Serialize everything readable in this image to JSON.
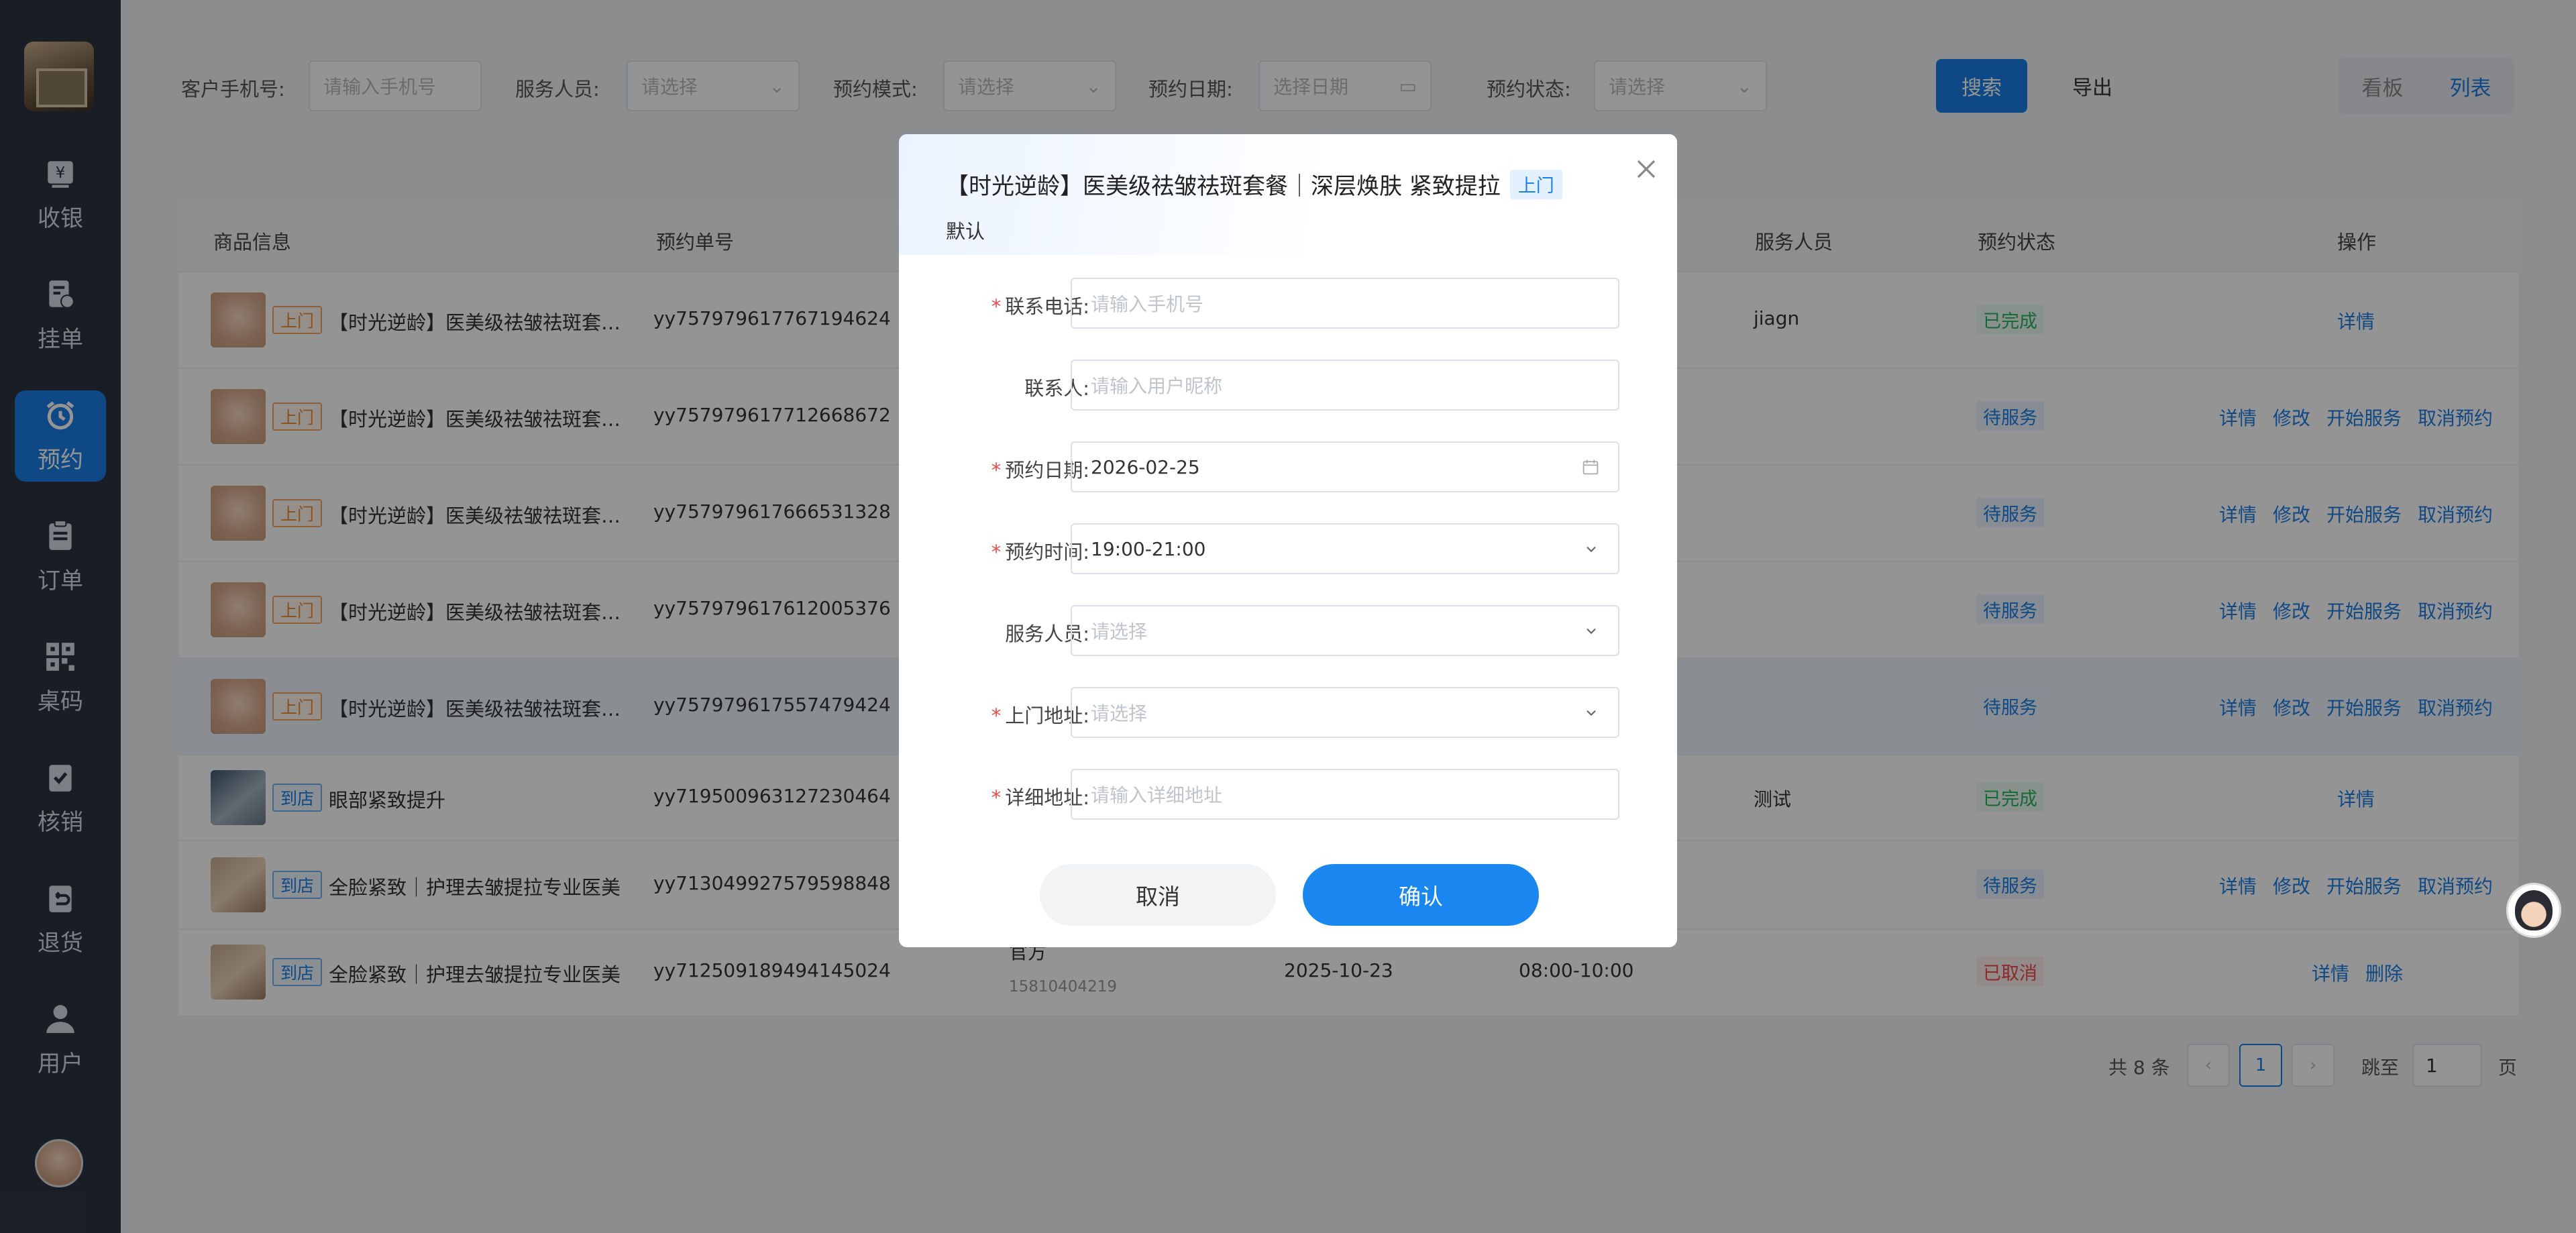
{
  "sidebar": {
    "items": [
      {
        "label": "收银",
        "icon": "cashier-icon"
      },
      {
        "label": "挂单",
        "icon": "hold-order-icon"
      },
      {
        "label": "预约",
        "icon": "alarm-clock-icon"
      },
      {
        "label": "订单",
        "icon": "clipboard-icon"
      },
      {
        "label": "桌码",
        "icon": "qr-code-icon"
      },
      {
        "label": "核销",
        "icon": "check-clipboard-icon"
      },
      {
        "label": "退货",
        "icon": "return-icon"
      },
      {
        "label": "用户",
        "icon": "user-icon"
      }
    ]
  },
  "filters": {
    "phone_label": "客户手机号:",
    "phone_placeholder": "请输入手机号",
    "staff_label": "服务人员:",
    "staff_placeholder": "请选择",
    "mode_label": "预约模式:",
    "mode_placeholder": "请选择",
    "date_label": "预约日期:",
    "date_placeholder": "选择日期",
    "status_label": "预约状态:",
    "status_placeholder": "请选择",
    "search": "搜索",
    "export": "导出",
    "view_board": "看板",
    "view_list": "列表"
  },
  "table": {
    "headers": {
      "product": "商品信息",
      "order_no": "预约单号",
      "staff": "服务人员",
      "status": "预约状态",
      "ops": "操作"
    },
    "rows": [
      {
        "tag": "上门",
        "name": "【时光逆龄】医美级祛皱祛斑套餐｜深层焕肤 紧致提拉",
        "order_no": "yy757979617767194624",
        "staff": "jiagn",
        "status": "已完成",
        "ops": [
          "详情"
        ]
      },
      {
        "tag": "上门",
        "name": "【时光逆龄】医美级祛皱祛斑套餐｜深层焕肤 紧致提拉",
        "order_no": "yy757979617712668672",
        "staff": "",
        "status": "待服务",
        "ops": [
          "详情",
          "修改",
          "开始服务",
          "取消预约"
        ]
      },
      {
        "tag": "上门",
        "name": "【时光逆龄】医美级祛皱祛斑套餐｜深层焕肤 紧致提拉",
        "order_no": "yy757979617666531328",
        "staff": "",
        "status": "待服务",
        "ops": [
          "详情",
          "修改",
          "开始服务",
          "取消预约"
        ]
      },
      {
        "tag": "上门",
        "name": "【时光逆龄】医美级祛皱祛斑套餐｜深层焕肤 紧致提拉",
        "order_no": "yy757979617612005376",
        "staff": "",
        "status": "待服务",
        "ops": [
          "详情",
          "修改",
          "开始服务",
          "取消预约"
        ]
      },
      {
        "tag": "上门",
        "name": "【时光逆龄】医美级祛皱祛斑套餐｜深层焕肤 紧致提拉",
        "order_no": "yy757979617557479424",
        "staff": "",
        "status": "待服务",
        "ops": [
          "详情",
          "修改",
          "开始服务",
          "取消预约"
        ]
      },
      {
        "tag": "到店",
        "name": "眼部紧致提升",
        "order_no": "yy719500963127230464",
        "staff": "测试",
        "status": "已完成",
        "ops": [
          "详情"
        ]
      },
      {
        "tag": "到店",
        "name": "全脸紧致｜护理去皱提拉专业医美",
        "order_no": "yy713049927579598848",
        "staff": "",
        "status": "待服务",
        "ops": [
          "详情",
          "修改",
          "开始服务",
          "取消预约"
        ]
      },
      {
        "tag": "到店",
        "name": "全脸紧致｜护理去皱提拉专业医美",
        "order_no": "yy712509189494145024",
        "staff": "",
        "status": "已取消",
        "ops": [
          "详情",
          "删除"
        ],
        "mode": "官方",
        "phone": "15810404219",
        "date": "2025-10-23",
        "time": "08:00-10:00"
      }
    ]
  },
  "pagination": {
    "total": "共 8 条",
    "current": "1",
    "jump_label": "跳至",
    "jump_value": "1",
    "suffix": "页"
  },
  "modal": {
    "title": "【时光逆龄】医美级祛皱祛斑套餐｜深层焕肤 紧致提拉",
    "title_tag": "上门",
    "subtitle": "默认",
    "fields": {
      "phone_label": "联系电话:",
      "phone_placeholder": "请输入手机号",
      "contact_label": "联系人:",
      "contact_placeholder": "请输入用户昵称",
      "date_label": "预约日期:",
      "date_value": "2026-02-25",
      "time_label": "预约时间:",
      "time_value": "19:00-21:00",
      "staff_label": "服务人员:",
      "staff_placeholder": "请选择",
      "address_label": "上门地址:",
      "address_placeholder": "请选择",
      "detail_label": "详细地址:",
      "detail_placeholder": "请输入详细地址"
    },
    "required_mark": "*",
    "cancel": "取消",
    "confirm": "确认"
  },
  "colors": {
    "primary": "#1a7fe6",
    "sidebar_bg": "#2c3543",
    "success": "#28b463",
    "danger": "#ee4b4b",
    "warning_tag": "#f08a2c"
  }
}
